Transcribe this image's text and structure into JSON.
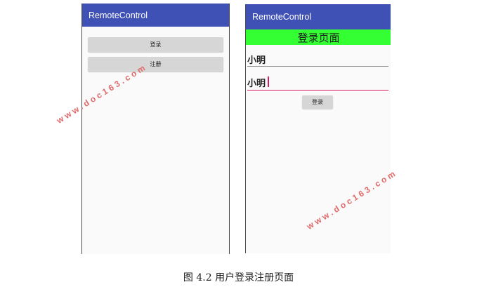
{
  "colors": {
    "app_bar": "#3f51b5",
    "banner": "#33ff33",
    "accent": "#d81b60",
    "button": "#d6d6d6"
  },
  "left_screen": {
    "app_title": "RemoteControl",
    "login_button": "登录",
    "register_button": "注册"
  },
  "right_screen": {
    "app_title": "RemoteControl",
    "banner_title": "登录页面",
    "username_value": "小明",
    "password_value": "小明",
    "login_button": "登录"
  },
  "watermarks": [
    "www.doc163.com",
    "www.doc163.com"
  ],
  "caption": "图 4.2  用户登录注册页面"
}
